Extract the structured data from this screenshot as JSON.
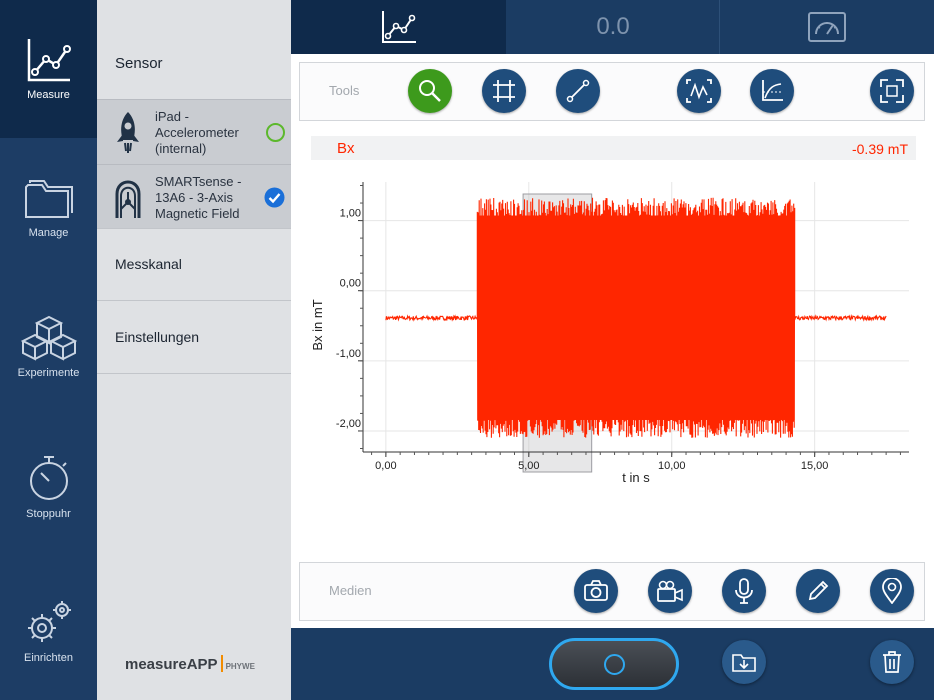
{
  "nav": {
    "items": [
      {
        "label": "Measure",
        "icon": "chart-icon",
        "active": true
      },
      {
        "label": "Manage",
        "icon": "folder-icon",
        "active": false
      },
      {
        "label": "Experimente",
        "icon": "cubes-icon",
        "active": false
      },
      {
        "label": "Stoppuhr",
        "icon": "stopwatch-icon",
        "active": false
      },
      {
        "label": "Einrichten",
        "icon": "gears-icon",
        "active": false
      }
    ]
  },
  "panel": {
    "sensor_heading": "Sensor",
    "sensors": [
      {
        "name": "iPad - Accelerometer (internal)",
        "lines": [
          "iPad -",
          "Accelerometer",
          "(internal)"
        ],
        "selected": false
      },
      {
        "name": "SMARTsense - 13A6 - 3-Axis Magnetic Field",
        "lines": [
          "SMARTsense -",
          "13A6 - 3-Axis",
          "Magnetic Field"
        ],
        "selected": true
      }
    ],
    "messkanal": "Messkanal",
    "einstellungen": "Einstellungen",
    "logo_text": "measureAPP",
    "logo_brand": "PHYWE"
  },
  "topbar": {
    "value_display": "0.0"
  },
  "tools": {
    "label": "Tools",
    "buttons": [
      "zoom-icon",
      "grid-select-icon",
      "line-tool-icon",
      "autoscale-icon",
      "axes-icon",
      "fullscreen-icon"
    ]
  },
  "channel": {
    "name": "Bx",
    "value": "-0.39 mT",
    "color": "#ff2600"
  },
  "chart_data": {
    "type": "line",
    "xlabel": "t in s",
    "ylabel": "Bx in mT",
    "xlim": [
      -0.8,
      18.3
    ],
    "ylim": [
      -2.3,
      1.55
    ],
    "xticks": [
      "0,00",
      "5,00",
      "10,00",
      "15,00"
    ],
    "xtick_values": [
      0,
      5,
      10,
      15
    ],
    "yticks": [
      "1,00",
      "0,00",
      "-1,00",
      "-2,00"
    ],
    "ytick_values": [
      1,
      0,
      -1,
      -2
    ],
    "grid": true,
    "series": [
      {
        "color": "#ff2600",
        "segments": [
          {
            "t_start": 0.0,
            "t_end": 3.2,
            "baseline": -0.39,
            "amplitude": 0.03,
            "kind": "noise"
          },
          {
            "t_start": 3.2,
            "t_end": 14.3,
            "center": -0.39,
            "max": 1.33,
            "min": -2.1,
            "kind": "oscillation"
          },
          {
            "t_start": 14.3,
            "t_end": 17.5,
            "baseline": -0.39,
            "amplitude": 0.03,
            "kind": "noise"
          }
        ]
      }
    ],
    "selection": {
      "t_start": 4.8,
      "t_end": 7.2
    }
  },
  "media": {
    "label": "Medien",
    "buttons": [
      "camera-icon",
      "video-camera-icon",
      "microphone-icon",
      "pencil-icon",
      "location-pin-icon"
    ]
  },
  "bottom": {
    "record_button": "record-button",
    "export_button": "download-folder-icon",
    "delete_button": "trash-icon"
  }
}
